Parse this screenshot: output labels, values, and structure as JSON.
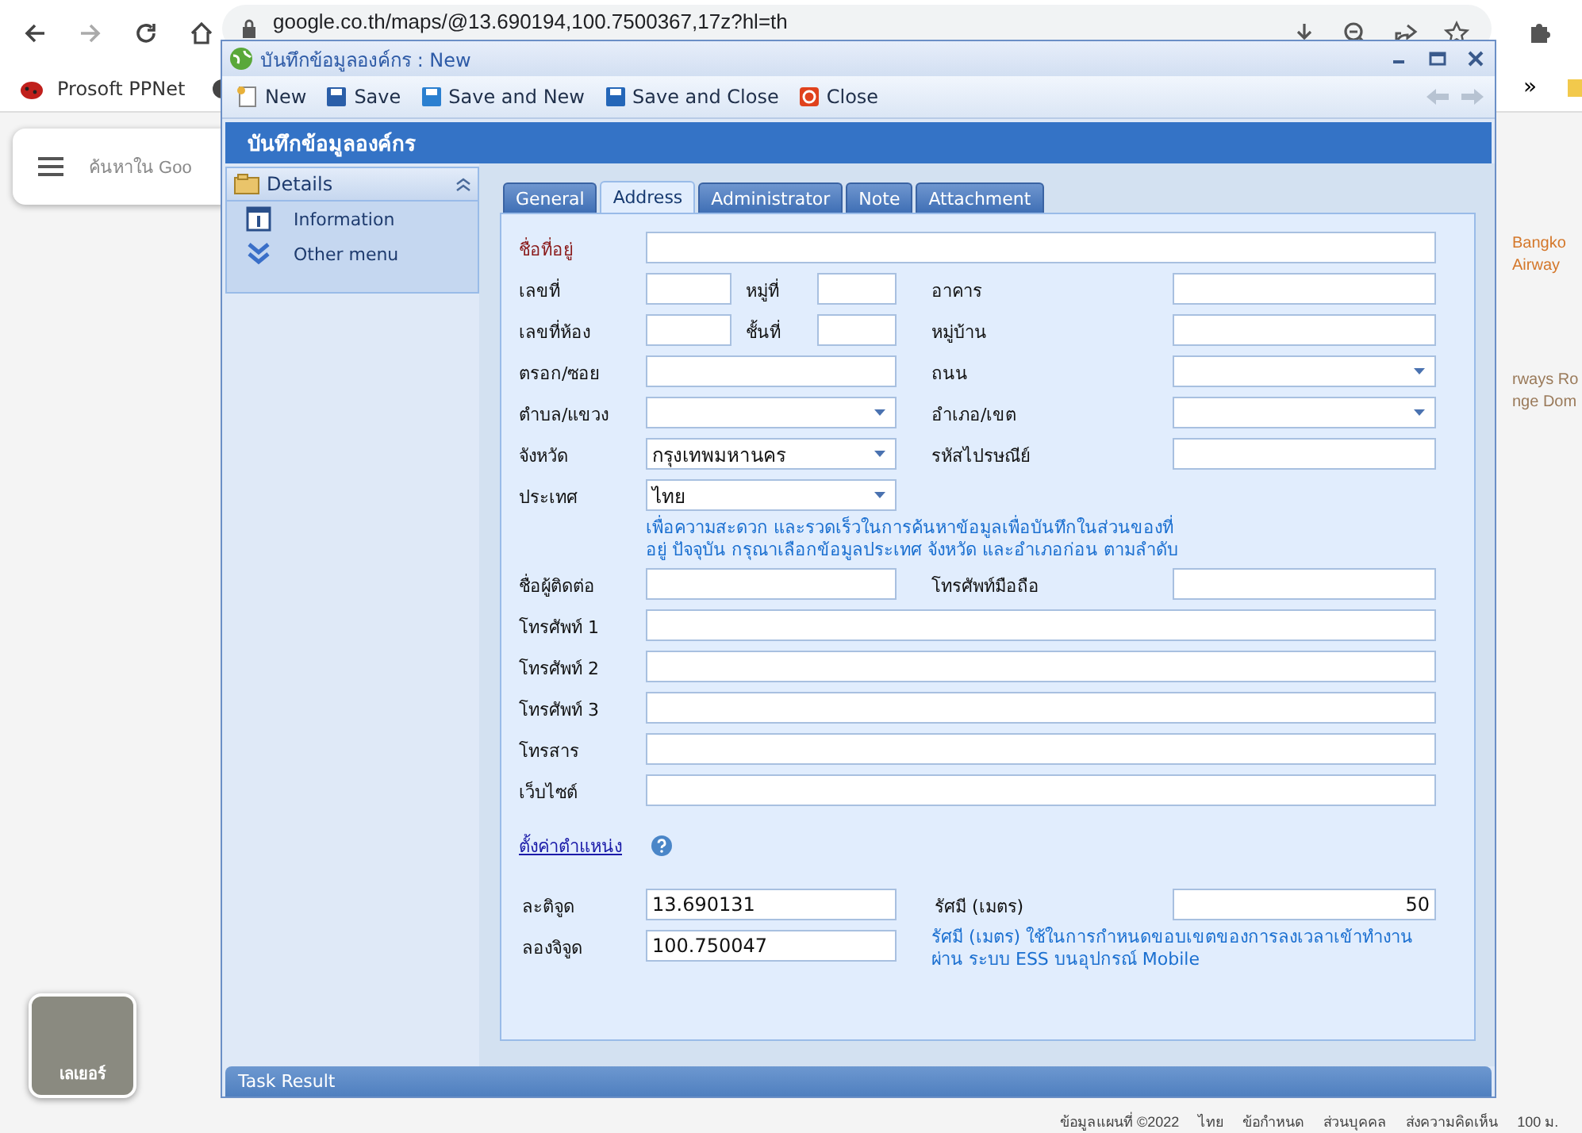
{
  "browser": {
    "url": "google.co.th/maps/@13.690194,100.7500367,17z?hl=th",
    "bookmarks": [
      {
        "label": "Prosoft PPNet"
      }
    ],
    "overflow": "»"
  },
  "map": {
    "search_placeholder": "ค้นหาใน Goo",
    "labels": [
      {
        "text": "Bangko",
        "kind": "poi"
      },
      {
        "text": "Airway",
        "kind": "poi"
      },
      {
        "text": "rways Ro",
        "kind": "place"
      },
      {
        "text": "nge Dom",
        "kind": "place"
      }
    ],
    "layer_button": "เลเยอร์",
    "footer": [
      "ข้อมูลแผนที่ ©2022",
      "ไทย",
      "ข้อกำหนด",
      "ส่วนบุคคล",
      "ส่งความคิดเห็น",
      "100 ม."
    ]
  },
  "dialog": {
    "title": "บันทึกข้อมูลองค์กร : New",
    "toolbar": [
      {
        "label": "New",
        "kind": "new"
      },
      {
        "label": "Save",
        "kind": "save"
      },
      {
        "label": "Save and New",
        "kind": "savenew"
      },
      {
        "label": "Save and Close",
        "kind": "saveclose"
      },
      {
        "label": "Close",
        "kind": "close"
      }
    ],
    "header": "บันทึกข้อมูลองค์กร",
    "sidebar": {
      "section": "Details",
      "items": [
        {
          "label": "Information",
          "kind": "info"
        },
        {
          "label": "Other menu",
          "kind": "more"
        }
      ]
    },
    "tabs": [
      {
        "label": "General",
        "selected": false
      },
      {
        "label": "Address",
        "selected": true
      },
      {
        "label": "Administrator",
        "selected": false
      },
      {
        "label": "Note",
        "selected": false
      },
      {
        "label": "Attachment",
        "selected": false
      }
    ],
    "form": [
      {
        "kind": "full",
        "fields": [
          {
            "label": "ชื่อที่อยู่",
            "required": true,
            "kind": "text"
          }
        ]
      },
      {
        "kind": "quad",
        "fields": [
          {
            "label": "เลขที่",
            "required": false,
            "kind": "text"
          },
          {
            "label": "หมู่ที่",
            "required": false,
            "kind": "text"
          },
          {
            "label": "อาคาร",
            "required": false,
            "kind": "text"
          }
        ]
      },
      {
        "kind": "quad",
        "fields": [
          {
            "label": "เลขที่ห้อง",
            "required": false,
            "kind": "text"
          },
          {
            "label": "ชั้นที่",
            "required": false,
            "kind": "text"
          },
          {
            "label": "หมู่บ้าน",
            "required": false,
            "kind": "text"
          }
        ]
      },
      {
        "kind": "pair",
        "fields": [
          {
            "label": "ตรอก/ซอย",
            "required": false,
            "kind": "text"
          },
          {
            "label": "ถนน",
            "required": false,
            "kind": "select"
          }
        ]
      },
      {
        "kind": "pair",
        "fields": [
          {
            "label": "ตำบล/แขวง",
            "required": false,
            "kind": "select"
          },
          {
            "label": "อำเภอ/เขต",
            "required": false,
            "kind": "select"
          }
        ]
      },
      {
        "kind": "pair",
        "fields": [
          {
            "label": "จังหวัด",
            "required": false,
            "kind": "select",
            "value": "กรุงเทพมหานคร"
          },
          {
            "label": "รหัสไปรษณีย์",
            "required": false,
            "kind": "text"
          }
        ]
      },
      {
        "kind": "single",
        "fields": [
          {
            "label": "ประเทศ",
            "required": false,
            "kind": "select",
            "value": "ไทย"
          }
        ]
      },
      {
        "kind": "note",
        "note": "เพื่อความสะดวก และรวดเร็วในการค้นหาข้อมูลเพื่อบันทึกในส่วนของที่อยู่ ปัจจุบัน กรุณาเลือกข้อมูลประเทศ จังหวัด และอำเภอก่อน ตามลำดับ"
      },
      {
        "kind": "pair",
        "fields": [
          {
            "label": "ชื่อผู้ติดต่อ",
            "required": false,
            "kind": "text"
          },
          {
            "label": "โทรศัพท์มือถือ",
            "required": false,
            "kind": "text"
          }
        ]
      },
      {
        "kind": "full",
        "fields": [
          {
            "label": "โทรศัพท์ 1",
            "required": false,
            "kind": "text"
          }
        ]
      },
      {
        "kind": "full",
        "fields": [
          {
            "label": "โทรศัพท์ 2",
            "required": false,
            "kind": "text"
          }
        ]
      },
      {
        "kind": "full",
        "fields": [
          {
            "label": "โทรศัพท์ 3",
            "required": false,
            "kind": "text"
          }
        ]
      },
      {
        "kind": "full",
        "fields": [
          {
            "label": "โทรสาร",
            "required": false,
            "kind": "text"
          }
        ]
      },
      {
        "kind": "full",
        "fields": [
          {
            "label": "เว็บไซต์",
            "required": false,
            "kind": "text"
          }
        ]
      },
      {
        "kind": "link",
        "link": "ตั้งค่าตำแหน่ง"
      },
      {
        "kind": "pair",
        "fields": [
          {
            "label": "ละติจูด",
            "required": false,
            "kind": "text",
            "value": "13.690131"
          },
          {
            "label": "รัศมี (เมตร)",
            "required": false,
            "kind": "number",
            "value": "50"
          }
        ]
      },
      {
        "kind": "pairnote",
        "fields": [
          {
            "label": "ลองจิจูด",
            "required": false,
            "kind": "text",
            "value": "100.750047"
          }
        ],
        "note": "รัศมี (เมตร) ใช้ในการกำหนดขอบเขตของการลงเวลาเข้าทำงานผ่าน ระบบ ESS บนอุปกรณ์ Mobile"
      }
    ],
    "task_result": "Task Result"
  }
}
